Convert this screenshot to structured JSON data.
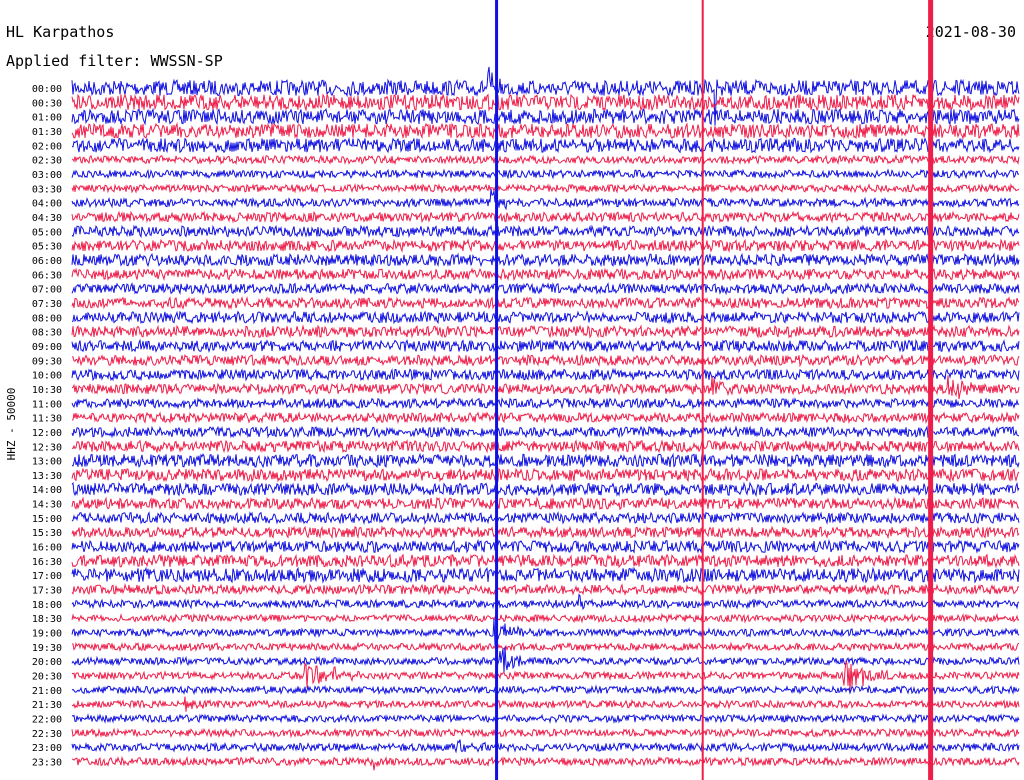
{
  "station": "HL Karpathos",
  "date": "2021-08-30",
  "filter": "Applied filter: WWSSN-SP",
  "channel_label": "HHZ - 50000",
  "colors": {
    "trace_a": "#1010e0",
    "trace_b": "#ee1d49",
    "text": "#000000",
    "background": "#ffffff"
  },
  "chart_data": {
    "type": "line",
    "title": "HL Karpathos",
    "subtitle": "Applied filter: WWSSN-SP",
    "date": "2021-08-30",
    "ylabel": "HHZ - 50000",
    "xlabel": "",
    "grid": false,
    "row_minutes": 30,
    "row_times": [
      "00:00",
      "00:30",
      "01:00",
      "01:30",
      "02:00",
      "02:30",
      "03:00",
      "03:30",
      "04:00",
      "04:30",
      "05:00",
      "05:30",
      "06:00",
      "06:30",
      "07:00",
      "07:30",
      "08:00",
      "08:30",
      "09:00",
      "09:30",
      "10:00",
      "10:30",
      "11:00",
      "11:30",
      "12:00",
      "12:30",
      "13:00",
      "13:30",
      "14:00",
      "14:30",
      "15:00",
      "15:30",
      "16:00",
      "16:30",
      "17:00",
      "17:30",
      "18:00",
      "18:30",
      "19:00",
      "19:30",
      "20:00",
      "20:30",
      "21:00",
      "21:30",
      "22:00",
      "22:30",
      "23:00",
      "23:30"
    ],
    "row_colors": [
      "trace_a",
      "trace_b"
    ],
    "noise_level": [
      1.0,
      1.0,
      0.95,
      0.9,
      0.85,
      0.3,
      0.3,
      0.25,
      0.35,
      0.45,
      0.55,
      0.6,
      0.65,
      0.55,
      0.5,
      0.55,
      0.6,
      0.6,
      0.6,
      0.55,
      0.55,
      0.5,
      0.45,
      0.45,
      0.5,
      0.6,
      0.75,
      0.7,
      0.7,
      0.6,
      0.55,
      0.55,
      0.65,
      0.7,
      0.85,
      0.45,
      0.3,
      0.25,
      0.25,
      0.25,
      0.25,
      0.25,
      0.25,
      0.25,
      0.25,
      0.25,
      0.3,
      0.3
    ],
    "events": [
      {
        "row": 0,
        "minute": 13.2,
        "amplitude": 18,
        "duration_min": 0.4
      },
      {
        "row": 8,
        "minute": 13.3,
        "amplitude": 14,
        "duration_min": 0.8
      },
      {
        "row": 0,
        "minute": 20.4,
        "amplitude": 30,
        "duration_min": 0.1
      },
      {
        "row": 21,
        "minute": 20.3,
        "amplitude": 12,
        "duration_min": 0.5
      },
      {
        "row": 38,
        "minute": 13.4,
        "amplitude": 16,
        "duration_min": 0.9
      },
      {
        "row": 40,
        "minute": 13.5,
        "amplitude": 18,
        "duration_min": 1.0
      },
      {
        "row": 36,
        "minute": 16.1,
        "amplitude": 10,
        "duration_min": 0.5
      },
      {
        "row": 41,
        "minute": 7.4,
        "amplitude": 14,
        "duration_min": 2.0
      },
      {
        "row": 43,
        "minute": 3.6,
        "amplitude": 12,
        "duration_min": 0.6
      },
      {
        "row": 46,
        "minute": 12.2,
        "amplitude": 8,
        "duration_min": 1.0
      },
      {
        "row": 41,
        "minute": 24.5,
        "amplitude": 16,
        "duration_min": 1.5
      },
      {
        "row": 21,
        "minute": 27.8,
        "amplitude": 12,
        "duration_min": 1.0
      },
      {
        "row": 47,
        "minute": 9.6,
        "amplitude": 7,
        "duration_min": 0.4
      }
    ]
  }
}
